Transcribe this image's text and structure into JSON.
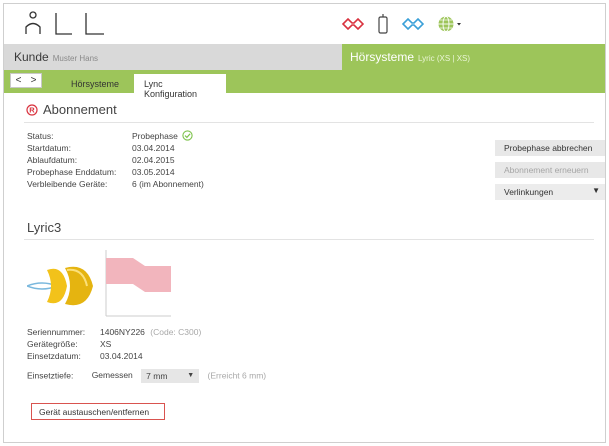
{
  "header": {
    "icons": [
      "person-icon",
      "ear-left-red-icon",
      "phone-device-icon",
      "ear-right-blue-icon",
      "globe-icon"
    ]
  },
  "context": {
    "kunde_label": "Kunde",
    "kunde_value": "Muster Hans",
    "hoersysteme_label": "Hörsysteme",
    "hoersysteme_value": "Lyric (XS | XS)"
  },
  "tabs": {
    "nav_back": "<",
    "nav_forward": ">",
    "items": [
      "Hörsysteme",
      "Lync Konfiguration"
    ]
  },
  "abonnement": {
    "title": "Abonnement",
    "fields": [
      {
        "label": "Status:",
        "value": "Probephase"
      },
      {
        "label": "Startdatum:",
        "value": "03.04.2014"
      },
      {
        "label": "Ablaufdatum:",
        "value": "02.04.2015"
      },
      {
        "label": "Probephase Enddatum:",
        "value": "03.05.2014"
      },
      {
        "label": "Verbleibende Geräte:",
        "value": "6 (im Abonnement)"
      }
    ]
  },
  "actions": {
    "cancel_trial": "Probephase abbrechen",
    "renew": "Abonnement erneuern",
    "links": "Verlinkungen"
  },
  "device": {
    "title": "Lyric3",
    "fields": [
      {
        "label": "Seriennummer:",
        "value": "1406NY226",
        "note": "(Code: C300)"
      },
      {
        "label": "Gerätegröße:",
        "value": "XS",
        "note": ""
      },
      {
        "label": "Einsetzdatum:",
        "value": "03.04.2014",
        "note": ""
      }
    ],
    "depth_label": "Einsetztiefe:",
    "depth_mode": "Gemessen",
    "depth_value": "7 mm",
    "depth_note": "(Erreicht 6 mm)",
    "replace_button": "Gerät austauschen/entfernen"
  },
  "colors": {
    "accent_green": "#9dc55a",
    "ear_red": "#d9333f",
    "ear_blue": "#3aa0d8",
    "check_green": "#7cc24a",
    "warning_red": "#d9534f"
  }
}
